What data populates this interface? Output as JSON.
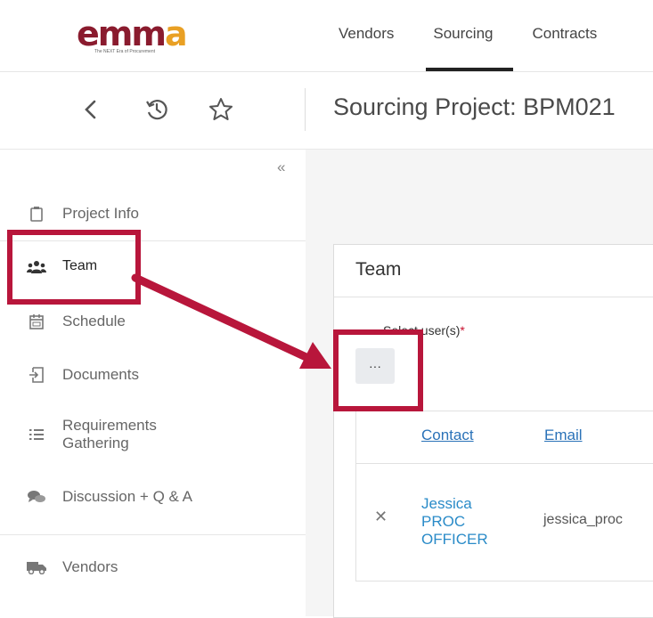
{
  "brand": {
    "logo_text_main": "emm",
    "logo_text_accent": "a",
    "logo_tagline": "The NEXT Era of Procurement",
    "color_primary": "#8a1b2e",
    "color_accent": "#e9a024"
  },
  "top_nav": {
    "items": [
      {
        "label": "Vendors",
        "active": false
      },
      {
        "label": "Sourcing",
        "active": true
      },
      {
        "label": "Contracts",
        "active": false
      }
    ]
  },
  "toolbar": {
    "back_icon": "chevron-left-icon",
    "history_icon": "history-icon",
    "favorite_icon": "star-icon"
  },
  "page": {
    "title": "Sourcing Project: BPM021"
  },
  "sidebar": {
    "collapse_label": "«",
    "items": [
      {
        "label": "Project Info",
        "icon": "clipboard-icon"
      },
      {
        "label": "Team",
        "icon": "users-icon",
        "active": true
      },
      {
        "label": "Schedule",
        "icon": "calendar-icon"
      },
      {
        "label": "Documents",
        "icon": "document-import-icon"
      },
      {
        "label": "Requirements Gathering",
        "icon": "list-icon"
      },
      {
        "label": "Discussion + Q & A",
        "icon": "comments-icon"
      },
      {
        "label": "Vendors",
        "icon": "truck-icon"
      }
    ]
  },
  "team_panel": {
    "title": "Team",
    "select_label": "Select user(s)",
    "required_mark": "*",
    "picker_button_label": "···",
    "columns": [
      "Contact",
      "Email"
    ],
    "rows": [
      {
        "contact": "Jessica PROC OFFICER",
        "email": "jessica_proc"
      }
    ]
  },
  "annotation": {
    "color": "#b8163b"
  }
}
